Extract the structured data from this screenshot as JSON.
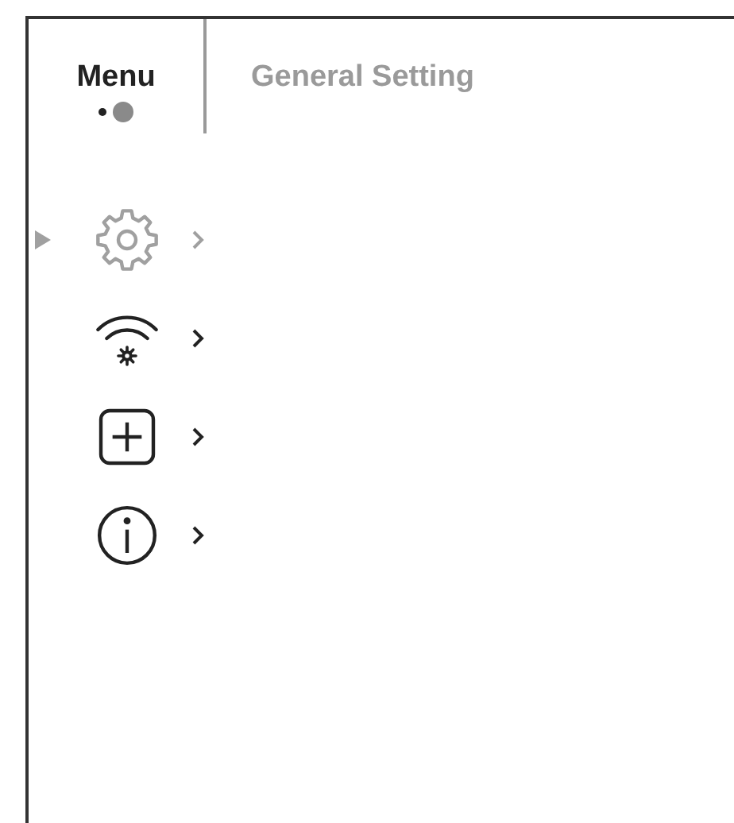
{
  "header": {
    "title": "Menu",
    "subtitle": "General Setting"
  },
  "page_dots": [
    {
      "selected": false
    },
    {
      "selected": true
    }
  ],
  "menu_items": [
    {
      "kind": "gear",
      "selected": true
    },
    {
      "kind": "wifi",
      "selected": false
    },
    {
      "kind": "plus",
      "selected": false
    },
    {
      "kind": "info",
      "selected": false
    }
  ]
}
